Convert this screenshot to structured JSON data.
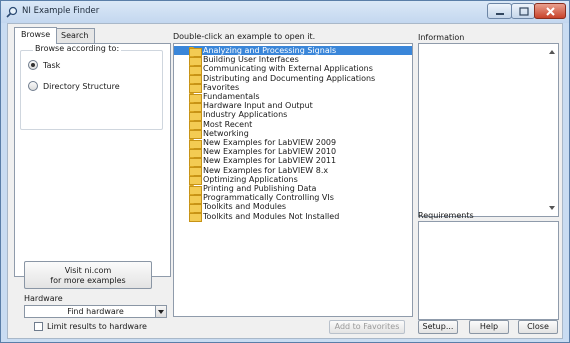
{
  "window": {
    "title": "NI Example Finder",
    "app_icon": "search-magnifier-icon"
  },
  "tabs": [
    {
      "label": "Browse",
      "active": true
    },
    {
      "label": "Search",
      "active": false
    }
  ],
  "browse": {
    "group_title": "Browse according to:",
    "options": [
      {
        "label": "Task",
        "checked": true
      },
      {
        "label": "Directory Structure",
        "checked": false
      }
    ]
  },
  "visit": {
    "line1": "Visit ni.com",
    "line2": "for more examples"
  },
  "hardware": {
    "label": "Hardware",
    "selected": "Find hardware",
    "limit_label": "Limit results to hardware"
  },
  "tree": {
    "caption": "Double-click an example to open it.",
    "items": [
      "Analyzing and Processing Signals",
      "Building User Interfaces",
      "Communicating with External Applications",
      "Distributing and Documenting Applications",
      "Favorites",
      "Fundamentals",
      "Hardware Input and Output",
      "Industry Applications",
      "Most Recent",
      "Networking",
      "New Examples for LabVIEW 2009",
      "New Examples for LabVIEW 2010",
      "New Examples for LabVIEW 2011",
      "New Examples for LabVIEW 8.x",
      "Optimizing Applications",
      "Printing and Publishing Data",
      "Programmatically Controlling VIs",
      "Toolkits and Modules",
      "Toolkits and Modules Not Installed"
    ],
    "selected_index": 0
  },
  "info": {
    "caption": "Information"
  },
  "requirements": {
    "caption": "Requirements"
  },
  "buttons": {
    "add_favorites": "Add to Favorites",
    "setup": "Setup...",
    "help": "Help",
    "close": "Close"
  },
  "colors": {
    "selection": "#3a86d9",
    "title_bar": "#c9dcf2",
    "close_button": "#c8432b"
  }
}
